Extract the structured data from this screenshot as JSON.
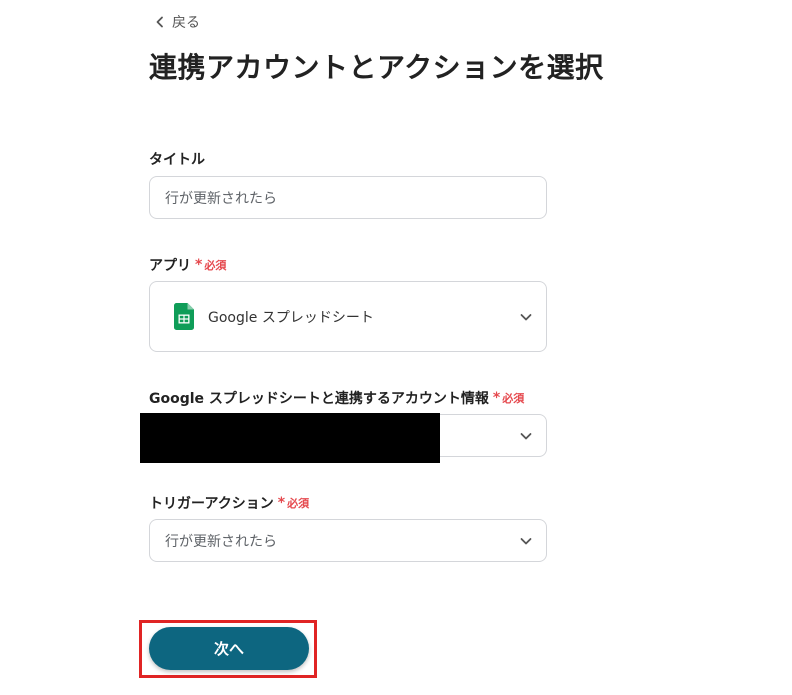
{
  "back_label": "戻る",
  "page_title": "連携アカウントとアクションを選択",
  "required_label": "必須",
  "title_field": {
    "label": "タイトル",
    "value": "行が更新されたら"
  },
  "app_field": {
    "label": "アプリ",
    "value": "Google スプレッドシート",
    "icon": "google-sheets-icon"
  },
  "account_field": {
    "label": "Google スプレッドシートと連携するアカウント情報"
  },
  "trigger_field": {
    "label": "トリガーアクション",
    "value": "行が更新されたら"
  },
  "next_button": "次へ",
  "colors": {
    "primary": "#0d6680",
    "required": "#e5484d",
    "highlight": "#e02424",
    "sheets_green": "#0f9d58"
  }
}
